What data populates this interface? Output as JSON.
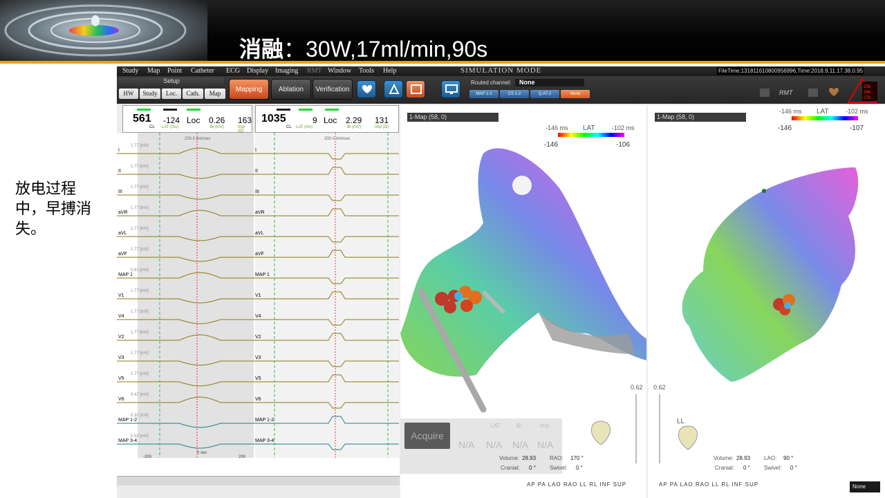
{
  "slide": {
    "title_bold": "消融",
    "title_rest": "：30W,17ml/min,90s",
    "note": "放电过程中，早搏消失。"
  },
  "menu": [
    "Study",
    "Map",
    "Point",
    "Catheter",
    "ECG",
    "Display",
    "Imaging",
    "RMT",
    "Window",
    "Tools",
    "Help"
  ],
  "mode_label": "SIMULATION MODE",
  "file_time": "FileTime:131811610800956996,Time:2018.9.11.17.38.0.95",
  "toolbar": {
    "setup_label": "Setup",
    "setup_buttons": [
      "HW",
      "Study",
      "Loc.",
      "Cath.",
      "Map"
    ],
    "mapping": "Mapping",
    "ablation": "Ablation",
    "verification": "Verification",
    "routed_label": "Routed channel:",
    "routed_value": "None",
    "channels": [
      "MAP 1-2",
      "CS 1-2",
      "Q.AT-2",
      "None"
    ]
  },
  "ecg_left": {
    "cl": "561",
    "cl_label": "CL",
    "lat": "-124",
    "lat_label": "LAT (ms)",
    "loc": "Loc",
    "bi": "0.26",
    "bi_label": "Bi (mV)",
    "imp": "163",
    "imp_label": "Imp (Ω)",
    "speed": "200.0 mm/sec",
    "time_axis": [
      "-200",
      "0 sec",
      "200"
    ]
  },
  "ecg_right": {
    "cl": "1035",
    "cl_label": "CL",
    "lat": "9",
    "lat_label": "LAT (ms)",
    "loc": "Loc",
    "bi": "2.29",
    "bi_label": "Bi (mV)",
    "imp": "131",
    "imp_label": "Imp (Ω)",
    "speed": "200.0 mm/sec"
  },
  "channels": [
    {
      "name": "I",
      "scale": "1.77 [mV]"
    },
    {
      "name": "II",
      "scale": "1.77 [mV]"
    },
    {
      "name": "III",
      "scale": "1.77 [mV]"
    },
    {
      "name": "aVR",
      "scale": "1.77 [mV]"
    },
    {
      "name": "aVL",
      "scale": "1.77 [mV]"
    },
    {
      "name": "aVF",
      "scale": "1.77 [mV]"
    },
    {
      "name": "MAP 1",
      "scale": "0.91 [mV]"
    },
    {
      "name": "V1",
      "scale": "1.77 [mV]"
    },
    {
      "name": "V4",
      "scale": "1.77 [mV]"
    },
    {
      "name": "V2",
      "scale": "1.77 [mV]"
    },
    {
      "name": "V3",
      "scale": "1.77 [mV]"
    },
    {
      "name": "V5",
      "scale": "1.77 [mV]"
    },
    {
      "name": "V6",
      "scale": "0.47 [mV]"
    },
    {
      "name": "MAP 1-2",
      "scale": "0.32 [mV]"
    },
    {
      "name": "MAP 3-4",
      "scale": "0.52 [mV]"
    }
  ],
  "map1": {
    "title": "1-Map (58, 0)",
    "lat_label": "LAT",
    "lat_min_top": "-146 ms",
    "lat_max_top": "-102 ms",
    "lat_min": "-146",
    "lat_max": "-106",
    "opacity": "0.62",
    "volume_label": "Volume:",
    "volume": "28.93",
    "view_label": "RAO:",
    "view_value": "170 °",
    "cranial_label": "Cranial:",
    "cranial": "0 °",
    "swivel_label": "Swivel:",
    "swivel": "0 °",
    "views": [
      "AP",
      "PA",
      "LAO",
      "RAO",
      "LL",
      "RL",
      "INF",
      "SUP"
    ]
  },
  "map2": {
    "title": "1-Map (58, 0)",
    "lat_label": "LAT",
    "lat_min_top": "-146 ms",
    "lat_max_top": "-102 ms",
    "lat_min": "-146",
    "lat_max": "-107",
    "opacity": "0.62",
    "orient": "LL",
    "volume_label": "Volume:",
    "volume": "28.93",
    "view_label": "LAO:",
    "view_value": "90 °",
    "cranial_label": "Cranial:",
    "cranial": "0 °",
    "swivel_label": "Swivel:",
    "swivel": "0 °",
    "views": [
      "AP",
      "PA",
      "LAO",
      "RAO",
      "LL",
      "RL",
      "INF",
      "SUP"
    ],
    "dropdown": "None"
  },
  "acquire": {
    "button": "Acquire",
    "headers": [
      "LAT",
      "Bi",
      "Imp"
    ],
    "values": [
      "N/A",
      "N/A",
      "N/A",
      "N/A"
    ]
  },
  "colors": {
    "accent": "#e8a21a",
    "active_button": "#e0662e",
    "lat_gradient": [
      "#ff0000",
      "#ffff00",
      "#00ff00",
      "#00ffff",
      "#0000ff",
      "#ff00ff"
    ]
  }
}
